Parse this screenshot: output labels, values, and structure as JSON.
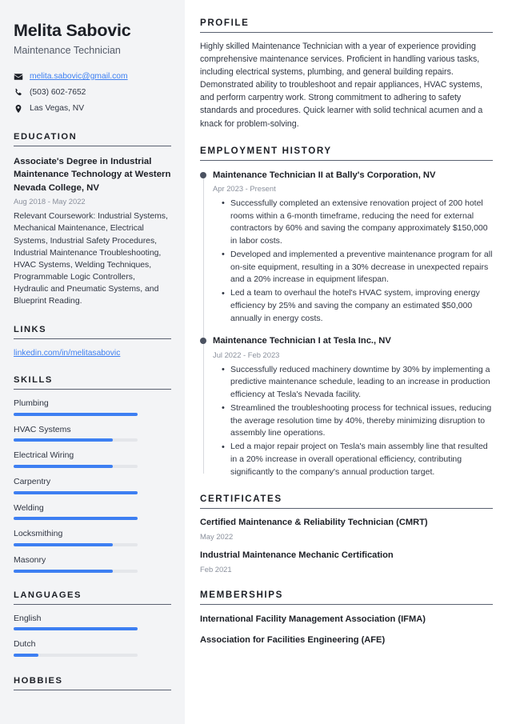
{
  "accent_color": "#3d7ff2",
  "sidebar_bg": "#f3f4f6",
  "header": {
    "name": "Melita Sabovic",
    "job_title": "Maintenance Technician",
    "contacts": [
      {
        "icon": "envelope-icon",
        "value": "melita.sabovic@gmail.com",
        "is_link": true
      },
      {
        "icon": "phone-icon",
        "value": "(503) 602-7652",
        "is_link": false
      },
      {
        "icon": "location-pin-icon",
        "value": "Las Vegas, NV",
        "is_link": false
      }
    ]
  },
  "sidebar": {
    "education": {
      "heading": "EDUCATION",
      "degree": "Associate's Degree in Industrial Maintenance Technology at Western Nevada College, NV",
      "dates": "Aug 2018 - May 2022",
      "coursework": "Relevant Coursework: Industrial Systems, Mechanical Maintenance, Electrical Systems, Industrial Safety Procedures, Industrial Maintenance Troubleshooting, HVAC Systems, Welding Techniques, Programmable Logic Controllers, Hydraulic and Pneumatic Systems, and Blueprint Reading."
    },
    "links": {
      "heading": "LINKS",
      "items": [
        {
          "label": "linkedin.com/in/melitasabovic"
        }
      ]
    },
    "skills": {
      "heading": "SKILLS",
      "items": [
        {
          "label": "Plumbing",
          "level": 100
        },
        {
          "label": "HVAC Systems",
          "level": 80
        },
        {
          "label": "Electrical Wiring",
          "level": 80
        },
        {
          "label": "Carpentry",
          "level": 100
        },
        {
          "label": "Welding",
          "level": 100
        },
        {
          "label": "Locksmithing",
          "level": 80
        },
        {
          "label": "Masonry",
          "level": 80
        }
      ]
    },
    "languages": {
      "heading": "LANGUAGES",
      "items": [
        {
          "label": "English",
          "level": 100
        },
        {
          "label": "Dutch",
          "level": 20
        }
      ]
    },
    "hobbies": {
      "heading": "HOBBIES"
    }
  },
  "main": {
    "profile": {
      "heading": "PROFILE",
      "text": "Highly skilled Maintenance Technician with a year of experience providing comprehensive maintenance services. Proficient in handling various tasks, including electrical systems, plumbing, and general building repairs. Demonstrated ability to troubleshoot and repair appliances, HVAC systems, and perform carpentry work. Strong commitment to adhering to safety standards and procedures. Quick learner with solid technical acumen and a knack for problem-solving."
    },
    "employment": {
      "heading": "EMPLOYMENT HISTORY",
      "jobs": [
        {
          "title": "Maintenance Technician II at Bally's Corporation, NV",
          "dates": "Apr 2023 - Present",
          "bullets": [
            "Successfully completed an extensive renovation project of 200 hotel rooms within a 6-month timeframe, reducing the need for external contractors by 60% and saving the company approximately $150,000 in labor costs.",
            "Developed and implemented a preventive maintenance program for all on-site equipment, resulting in a 30% decrease in unexpected repairs and a 20% increase in equipment lifespan.",
            "Led a team to overhaul the hotel's HVAC system, improving energy efficiency by 25% and saving the company an estimated $50,000 annually in energy costs."
          ]
        },
        {
          "title": "Maintenance Technician I at Tesla Inc., NV",
          "dates": "Jul 2022 - Feb 2023",
          "bullets": [
            "Successfully reduced machinery downtime by 30% by implementing a predictive maintenance schedule, leading to an increase in production efficiency at Tesla's Nevada facility.",
            "Streamlined the troubleshooting process for technical issues, reducing the average resolution time by 40%, thereby minimizing disruption to assembly line operations.",
            "Led a major repair project on Tesla's main assembly line that resulted in a 20% increase in overall operational efficiency, contributing significantly to the company's annual production target."
          ]
        }
      ]
    },
    "certificates": {
      "heading": "CERTIFICATES",
      "items": [
        {
          "name": "Certified Maintenance & Reliability Technician (CMRT)",
          "date": "May 2022"
        },
        {
          "name": "Industrial Maintenance Mechanic Certification",
          "date": "Feb 2021"
        }
      ]
    },
    "memberships": {
      "heading": "MEMBERSHIPS",
      "items": [
        {
          "name": "International Facility Management Association (IFMA)"
        },
        {
          "name": "Association for Facilities Engineering (AFE)"
        }
      ]
    }
  }
}
